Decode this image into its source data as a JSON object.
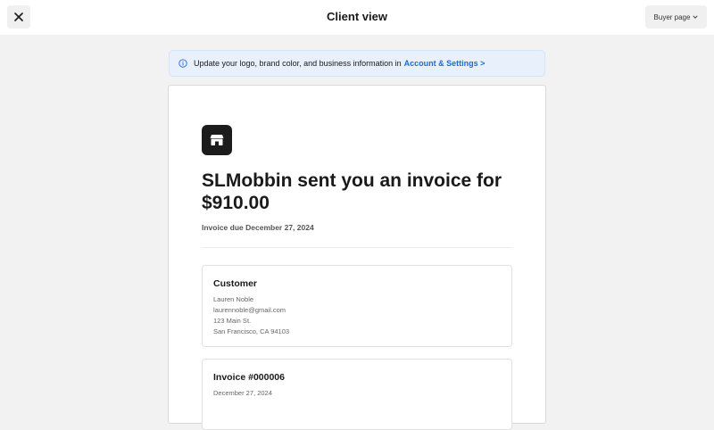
{
  "header": {
    "title": "Client view",
    "buyer_page_label": "Buyer page"
  },
  "banner": {
    "text": "Update your logo, brand color, and business information in",
    "link": "Account & Settings >"
  },
  "invoice_card": {
    "headline": "SLMobbin sent you an invoice for $910.00",
    "due_text": "Invoice due December 27, 2024",
    "customer": {
      "title": "Customer",
      "name": "Lauren Noble",
      "email": "laurennoble@gmail.com",
      "street": "123 Main St.",
      "city": "San Francisco, CA 94103"
    },
    "invoice": {
      "title": "Invoice #000006",
      "date": "December 27, 2024"
    }
  }
}
